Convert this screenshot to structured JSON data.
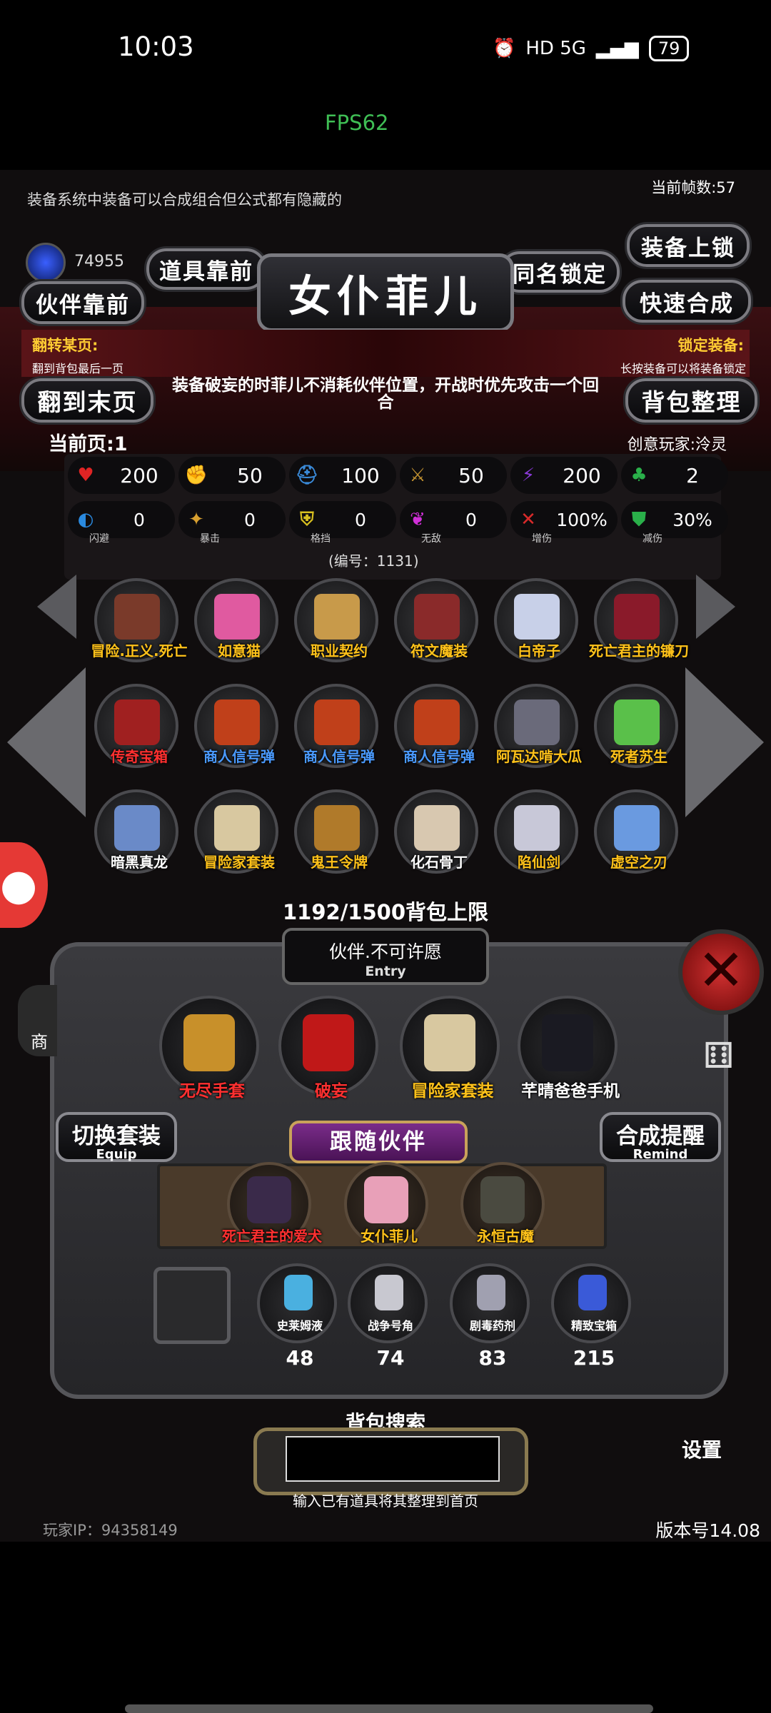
{
  "status_bar": {
    "time": "10:03",
    "indicators": "HD 5G",
    "battery": "79"
  },
  "fps": "FPS62",
  "hint_text": "装备系统中装备可以合成组合但公式都有隐藏的",
  "frame_count": "当前帧数:57",
  "coins": "74955",
  "buttons": {
    "item_front": "道具靠前",
    "partner_front": "伙伴靠前",
    "same_name_lock": "同名锁定",
    "equip_lock": "装备上锁",
    "quick_merge": "快速合成",
    "to_last_page": "翻到末页",
    "sort_bag": "背包整理"
  },
  "character_title": "女仆菲儿",
  "flip_page": {
    "title": "翻转某页:",
    "sub": "翻到背包最后一页"
  },
  "lock_equip": {
    "title": "锁定装备:",
    "sub": "长按装备可以将装备锁定"
  },
  "description": "装备破妄的时菲儿不消耗伙伴位置，开战时优先攻击一个回合",
  "current_page": "当前页:1",
  "creator": "创意玩家:泠灵",
  "stats_row1": [
    {
      "icon": "heart-icon",
      "color": "#e02424",
      "glyph": "♥",
      "value": "200"
    },
    {
      "icon": "fist-icon",
      "color": "#e0b020",
      "glyph": "✊",
      "value": "50"
    },
    {
      "icon": "helmet-icon",
      "color": "#3a8ad8",
      "glyph": "⛑",
      "value": "100"
    },
    {
      "icon": "sword-icon",
      "color": "#c09030",
      "glyph": "⚔",
      "value": "50"
    },
    {
      "icon": "lightning-icon",
      "color": "#8a3ad8",
      "glyph": "⚡",
      "value": "200"
    },
    {
      "icon": "clover-icon",
      "color": "#2ab04a",
      "glyph": "♣",
      "value": "2"
    }
  ],
  "stats_row2": [
    {
      "icon": "dodge-icon",
      "color": "#2a8ae0",
      "glyph": "◐",
      "value": "0",
      "label": "闪避"
    },
    {
      "icon": "crit-icon",
      "color": "#d8a030",
      "glyph": "✦",
      "value": "0",
      "label": "暴击"
    },
    {
      "icon": "shield-icon",
      "color": "#d8c020",
      "glyph": "⛨",
      "value": "0",
      "label": "格挡"
    },
    {
      "icon": "wings-icon",
      "color": "#d030d8",
      "glyph": "❦",
      "value": "0",
      "label": "无敌"
    },
    {
      "icon": "broken-sword-icon",
      "color": "#d82a2a",
      "glyph": "✕",
      "value": "100%",
      "label": "增伤"
    },
    {
      "icon": "reduce-shield-icon",
      "color": "#2ab04a",
      "glyph": "⛊",
      "value": "30%",
      "label": "减伤"
    }
  ],
  "serial": "(编号：1131)",
  "bag_items": [
    {
      "name": "冒险.正义.死亡",
      "color": "#ffc21a",
      "art": "#7a3a2a"
    },
    {
      "name": "如意猫",
      "color": "#ffc21a",
      "art": "#e05aa0"
    },
    {
      "name": "职业契约",
      "color": "#ffc21a",
      "art": "#c89a4a"
    },
    {
      "name": "符文魔装",
      "color": "#ffc21a",
      "art": "#8a2a2a"
    },
    {
      "name": "白帝子",
      "color": "#ffc21a",
      "art": "#c8d0e8"
    },
    {
      "name": "死亡君主的镰刀",
      "color": "#ffc21a",
      "art": "#8a1a2a"
    },
    {
      "name": "传奇宝箱",
      "color": "#ff3030",
      "art": "#a02020"
    },
    {
      "name": "商人信号弹",
      "color": "#4a9aff",
      "art": "#c0401a"
    },
    {
      "name": "商人信号弹",
      "color": "#4a9aff",
      "art": "#c0401a"
    },
    {
      "name": "商人信号弹",
      "color": "#4a9aff",
      "art": "#c0401a"
    },
    {
      "name": "阿瓦达啃大瓜",
      "color": "#ffc21a",
      "art": "#6a6a7a"
    },
    {
      "name": "死者苏生",
      "color": "#ffc21a",
      "art": "#5ac04a"
    },
    {
      "name": "暗黑真龙",
      "color": "#ffffff",
      "art": "#6a8ac8"
    },
    {
      "name": "冒险家套装",
      "color": "#ffc21a",
      "art": "#d8c8a0"
    },
    {
      "name": "鬼王令牌",
      "color": "#ffc21a",
      "art": "#b07a2a"
    },
    {
      "name": "化石骨丁",
      "color": "#ffffff",
      "art": "#d8c8b0"
    },
    {
      "name": "陷仙剑",
      "color": "#ffc21a",
      "art": "#c8c8d8"
    },
    {
      "name": "虚空之刃",
      "color": "#ffc21a",
      "art": "#6a9ae0"
    }
  ],
  "bag_limit": "1192/1500背包上限",
  "entry": {
    "title": "伙伴.不可许愿",
    "subtitle": "Entry"
  },
  "equipped": [
    {
      "name": "无尽手套",
      "color": "#ff3030",
      "art": "#c8902a"
    },
    {
      "name": "破妄",
      "color": "#ff3030",
      "art": "#c01818"
    },
    {
      "name": "冒险家套装",
      "color": "#ffc21a",
      "art": "#d8c8a0"
    },
    {
      "name": "芊晴爸爸手机",
      "color": "#ffffff",
      "art": "#1a1a22"
    }
  ],
  "switch_set": {
    "label": "切换套装",
    "sub": "Equip"
  },
  "merge_remind": {
    "label": "合成提醒",
    "sub": "Remind"
  },
  "shop_label": "商",
  "settings_label": "设置",
  "follow_title": "跟随伙伴",
  "companions": [
    {
      "name": "死亡君主的爱犬",
      "color": "#ff3030",
      "art": "#3a2a4a"
    },
    {
      "name": "女仆菲儿",
      "color": "#ffc21a",
      "art": "#e8a0b8"
    },
    {
      "name": "永恒古魔",
      "color": "#ffc21a",
      "art": "#4a4a40"
    }
  ],
  "consumables": [
    {
      "name": "史莱姆液",
      "count": "48",
      "art": "#4ab0e0"
    },
    {
      "name": "战争号角",
      "count": "74",
      "art": "#c8c8d0"
    },
    {
      "name": "剧毒药剂",
      "count": "83",
      "art": "#a0a0b0"
    },
    {
      "name": "精致宝箱",
      "count": "215",
      "art": "#3a5ad8"
    }
  ],
  "search": {
    "title": "背包搜索",
    "placeholder": "",
    "hint": "输入已有道具将其整理到首页"
  },
  "player_ip": "玩家IP：94358149",
  "version": "版本号14.08"
}
